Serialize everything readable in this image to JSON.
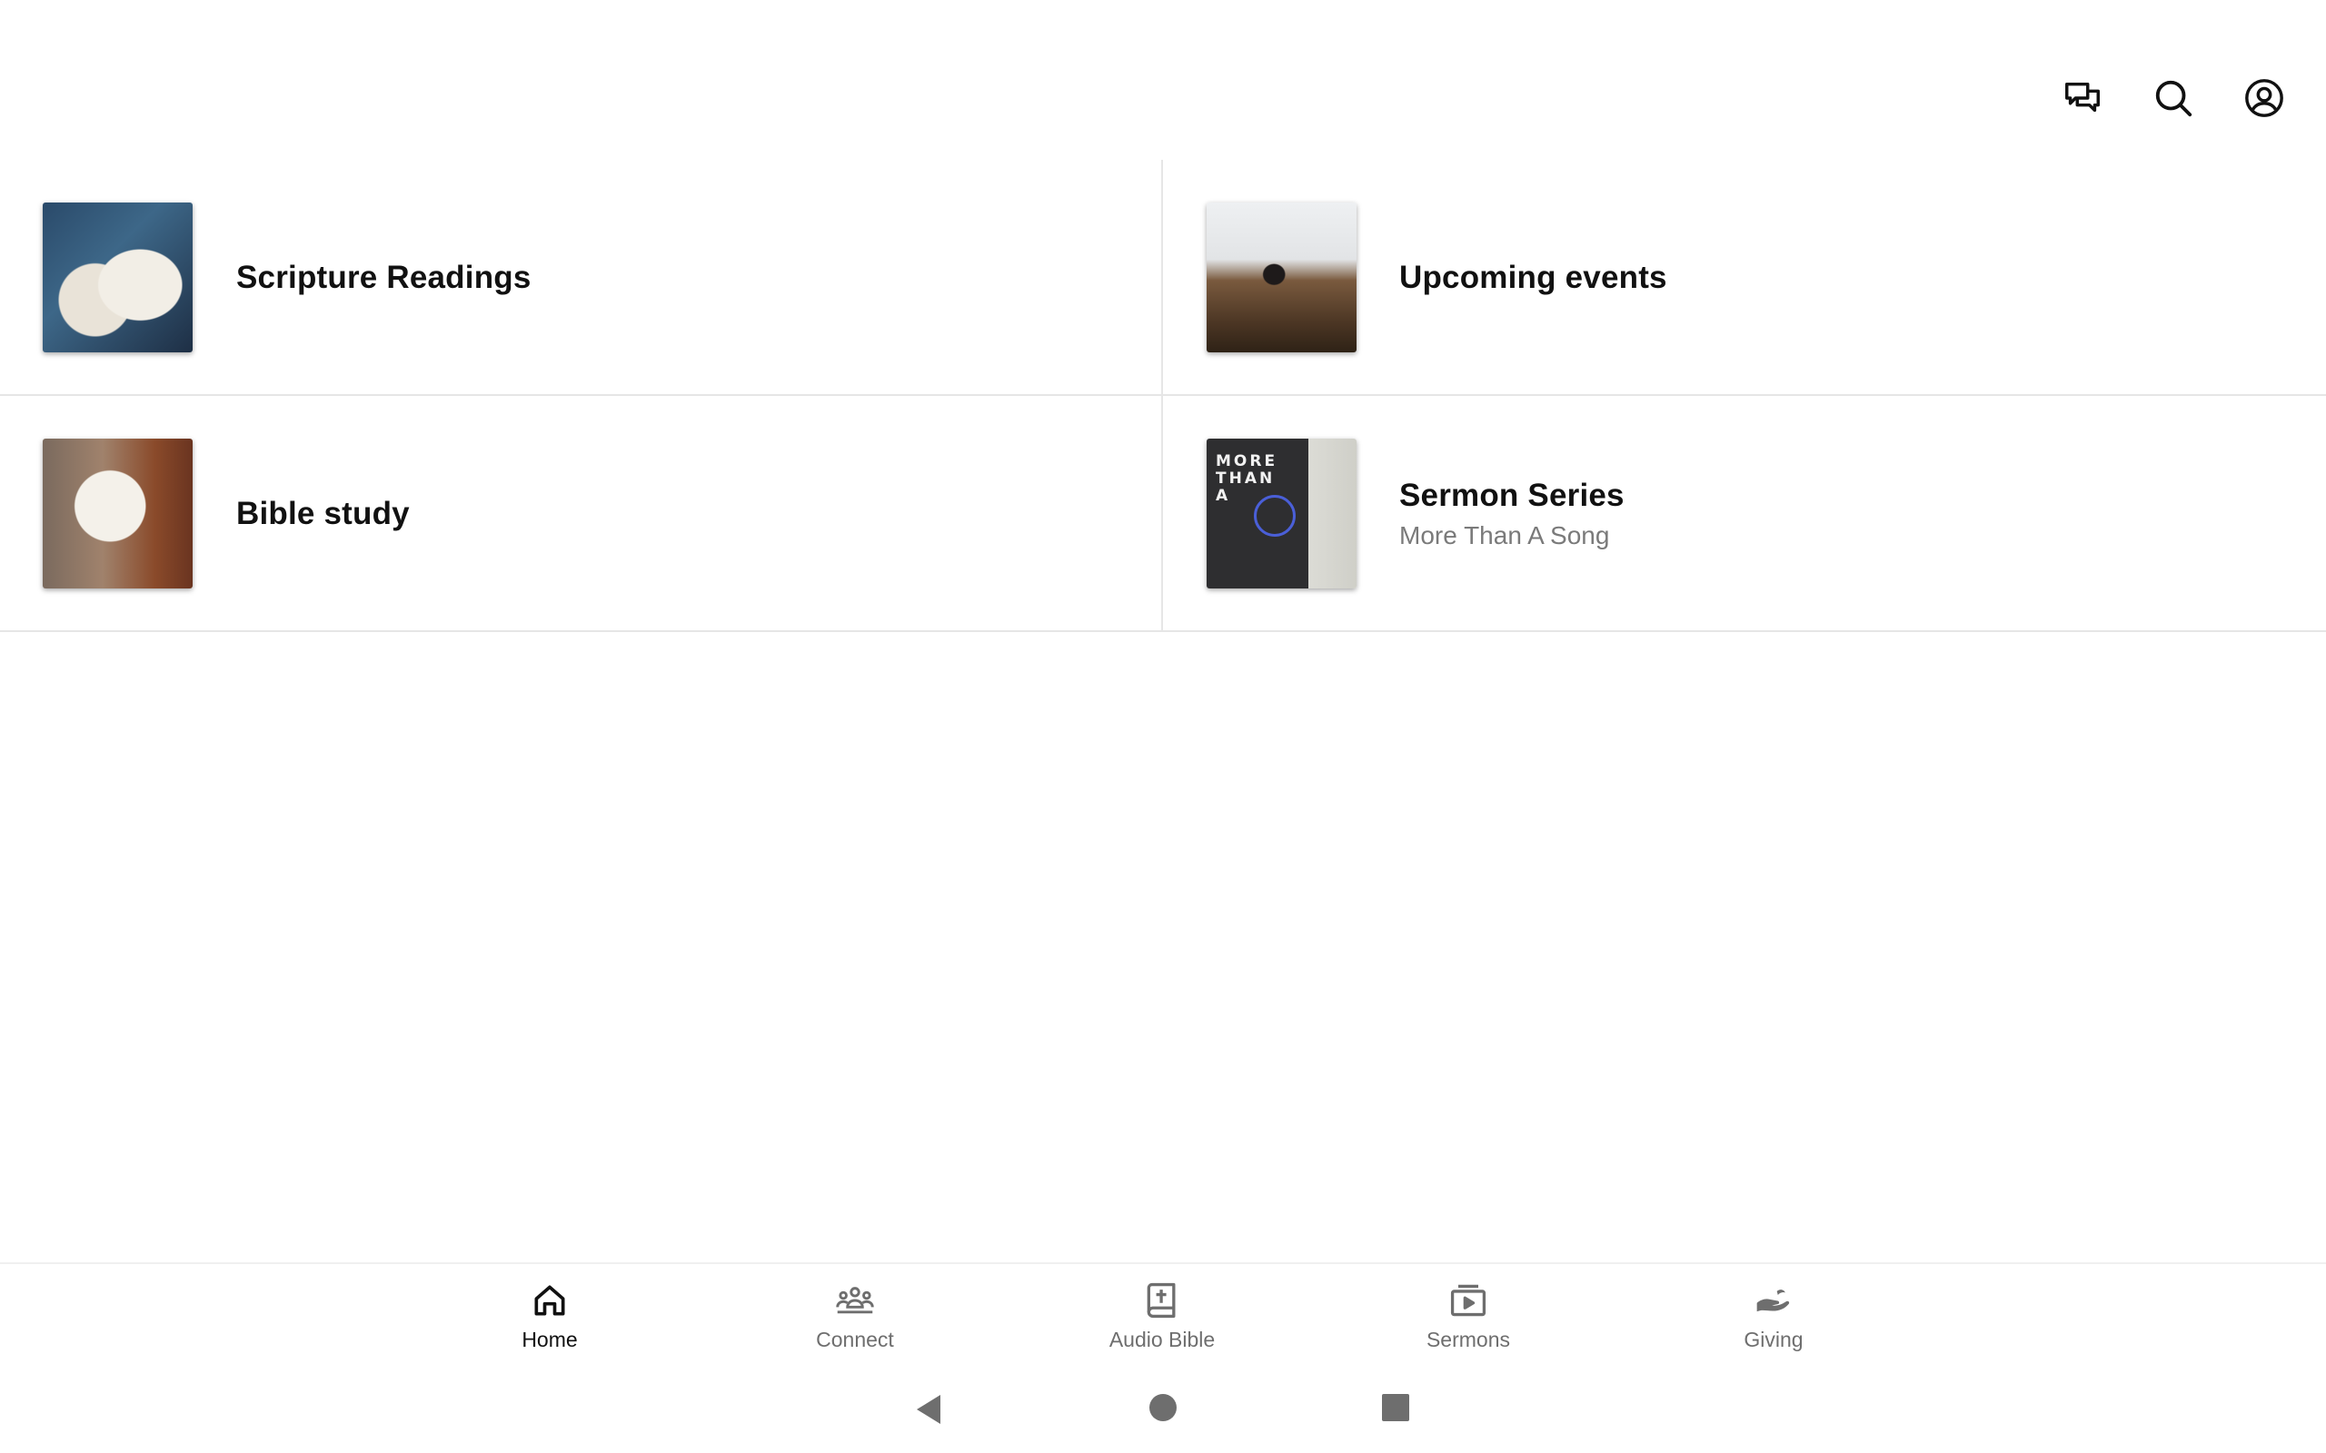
{
  "header": {
    "icons": [
      "chat-icon",
      "search-icon",
      "account-icon"
    ]
  },
  "tiles": [
    {
      "title": "Scripture Readings",
      "subtitle": ""
    },
    {
      "title": "Upcoming events",
      "subtitle": ""
    },
    {
      "title": "Bible study",
      "subtitle": ""
    },
    {
      "title": "Sermon Series",
      "subtitle": "More Than A Song"
    }
  ],
  "sermon_art": {
    "line1": "MORE",
    "line2": "THAN",
    "line3": "A"
  },
  "bottom_nav": {
    "items": [
      {
        "label": "Home",
        "icon": "home-icon",
        "active": true
      },
      {
        "label": "Connect",
        "icon": "people-icon",
        "active": false
      },
      {
        "label": "Audio Bible",
        "icon": "bible-icon",
        "active": false
      },
      {
        "label": "Sermons",
        "icon": "video-icon",
        "active": false
      },
      {
        "label": "Giving",
        "icon": "giving-hand-icon",
        "active": false
      }
    ]
  },
  "system_nav": [
    "back-icon",
    "home-circle-icon",
    "recents-icon"
  ],
  "colors": {
    "active": "#111111",
    "inactive": "#6e6e6e",
    "divider": "#e6e6e6"
  }
}
